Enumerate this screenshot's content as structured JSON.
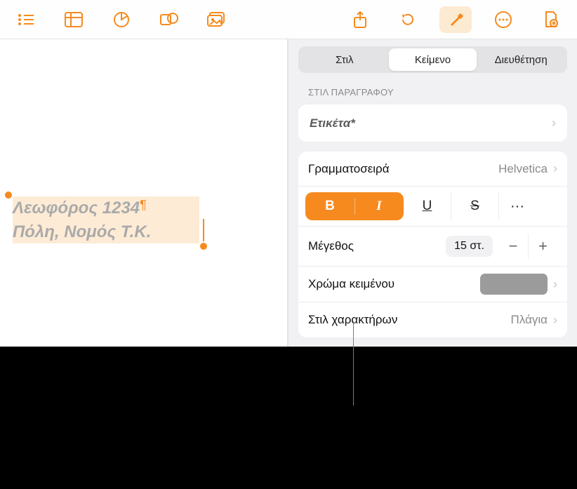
{
  "toolbar": {
    "icons": [
      "list-icon",
      "table-icon",
      "chart-icon",
      "shape-icon",
      "media-icon",
      "share-icon",
      "undo-icon",
      "format-icon",
      "more-icon",
      "document-icon"
    ]
  },
  "canvas": {
    "line1": "Λεωφόρος 1234",
    "line2": "Πόλη, Νομός Τ.Κ.",
    "pilcrow": "¶"
  },
  "inspector": {
    "tabs": {
      "style": "Στιλ",
      "text": "Κείμενο",
      "arrange": "Διευθέτηση"
    },
    "paragraph_section": "ΣΤΙΛ ΠΑΡΑΓΡΑΦΟΥ",
    "paragraph_style": "Ετικέτα*",
    "font_label": "Γραμματοσειρά",
    "font_value": "Helvetica",
    "bold": "B",
    "italic": "I",
    "underline": "U",
    "strike": "S",
    "more": "···",
    "size_label": "Μέγεθος",
    "size_value": "15 στ.",
    "minus": "−",
    "plus": "+",
    "color_label": "Χρώμα κειμένου",
    "color_value": "#9b9b9b",
    "charstyle_label": "Στιλ χαρακτήρων",
    "charstyle_value": "Πλάγια"
  }
}
